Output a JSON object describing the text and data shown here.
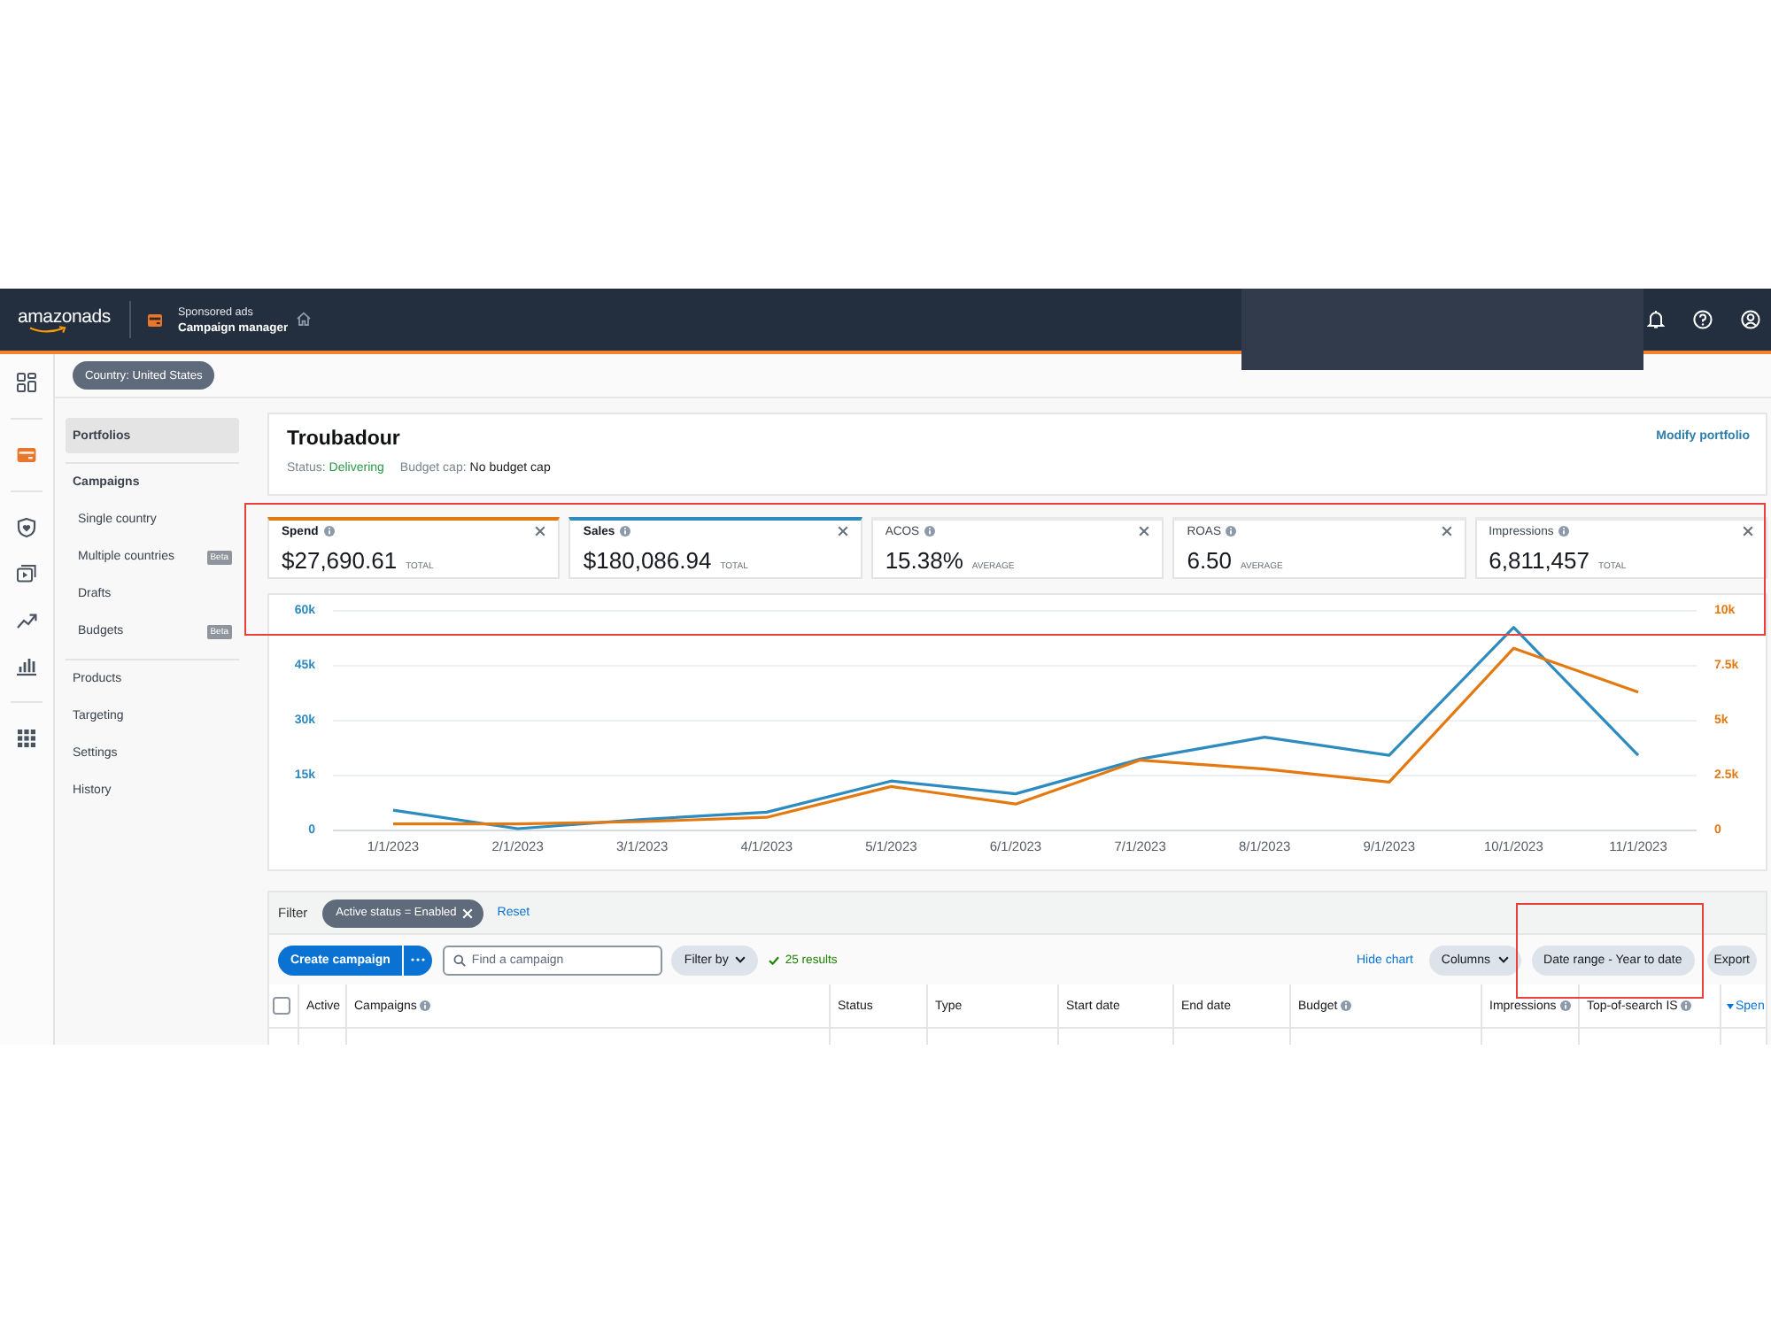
{
  "header": {
    "logo": "amazonads",
    "section": "Sponsored ads",
    "title": "Campaign manager",
    "redacted": true
  },
  "rail": {
    "groups": [
      {
        "items": [
          {
            "selected": false
          }
        ]
      },
      {
        "items": [
          {
            "selected": true
          }
        ]
      },
      {
        "items": [
          {
            "selected": false
          },
          {
            "selected": false
          },
          {
            "selected": false
          },
          {
            "selected": false
          }
        ]
      },
      {
        "items": [
          {
            "selected": false
          }
        ]
      }
    ]
  },
  "country_filter": "Country: United States",
  "sidebar": {
    "items": [
      {
        "label": "Portfolios",
        "selected": true
      },
      {
        "label": "Campaigns",
        "selected": false,
        "children": [
          {
            "label": "Single country",
            "selected": false
          },
          {
            "label": "Multiple countries",
            "selected": false,
            "badge": "Beta"
          },
          {
            "label": "Drafts",
            "selected": false
          },
          {
            "label": "Budgets",
            "selected": false,
            "badge": "Beta"
          }
        ]
      },
      {
        "label": "Products",
        "selected": false
      },
      {
        "label": "Targeting",
        "selected": false
      },
      {
        "label": "Settings",
        "selected": false
      },
      {
        "label": "History",
        "selected": false
      }
    ]
  },
  "portfolio": {
    "name": "Troubadour",
    "status_label": "Status:",
    "status": "Delivering",
    "budget_label": "Budget cap:",
    "budget": "No budget cap",
    "action": "Modify portfolio"
  },
  "metrics": [
    {
      "label": "Spend",
      "value": "$27,690.61",
      "unit": "TOTAL",
      "selected": true,
      "color": "#e47911"
    },
    {
      "label": "Sales",
      "value": "$180,086.94",
      "unit": "TOTAL",
      "selected": true,
      "color": "#2e8bc0"
    },
    {
      "label": "ACOS",
      "value": "15.38%",
      "unit": "AVERAGE",
      "selected": false
    },
    {
      "label": "ROAS",
      "value": "6.50",
      "unit": "AVERAGE",
      "selected": false
    },
    {
      "label": "Impressions",
      "value": "6,811,457",
      "unit": "TOTAL",
      "selected": false
    }
  ],
  "chart": {
    "chart_data": {
      "type": "line",
      "grid": true,
      "categories": [
        "1/1/2023",
        "2/1/2023",
        "3/1/2023",
        "4/1/2023",
        "5/1/2023",
        "6/1/2023",
        "7/1/2023",
        "8/1/2023",
        "9/1/2023",
        "10/1/2023",
        "11/1/2023"
      ],
      "series": [
        {
          "color": "#2e8bc0",
          "values": [
            5500,
            500,
            3000,
            5000,
            13500,
            10000,
            19500,
            25500,
            20500,
            55500,
            20500
          ]
        },
        {
          "color": "#e47911",
          "axis": "y2",
          "values": [
            300,
            300,
            400,
            600,
            2000,
            1200,
            3200,
            2800,
            2200,
            8300,
            6300
          ]
        }
      ],
      "ylim": [
        0,
        60000
      ],
      "yticks": [
        {
          "value": 0,
          "label": "0"
        },
        {
          "value": 15000,
          "label": "15k"
        },
        {
          "value": 30000,
          "label": "30k"
        },
        {
          "value": 45000,
          "label": "45k"
        },
        {
          "value": 60000,
          "label": "60k"
        }
      ],
      "y2lim": [
        0,
        10000
      ],
      "y2ticks": [
        {
          "value": 0,
          "label": "0"
        },
        {
          "value": 2500,
          "label": "2.5k"
        },
        {
          "value": 5000,
          "label": "5k"
        },
        {
          "value": 7500,
          "label": "7.5k"
        },
        {
          "value": 10000,
          "label": "10k"
        }
      ]
    }
  },
  "filter": {
    "label": "Filter",
    "chips": [
      {
        "label": "Active status = Enabled"
      }
    ],
    "reset": "Reset"
  },
  "toolbar": {
    "create": "Create campaign",
    "search": {
      "placeholder": "Find a campaign"
    },
    "filter_by": "Filter by",
    "results": "25 results",
    "hide_chart": "Hide chart",
    "columns": "Columns",
    "date_range": "Date range - Year to date",
    "export": "Export"
  },
  "table": {
    "select_all": {
      "checked": false
    },
    "columns": [
      {
        "label": "Active",
        "info": false,
        "sorted": false
      },
      {
        "label": "Campaigns",
        "info": true,
        "sorted": false
      },
      {
        "label": "Status",
        "info": false,
        "sorted": false
      },
      {
        "label": "Type",
        "info": false,
        "sorted": false
      },
      {
        "label": "Start date",
        "info": false,
        "sorted": false
      },
      {
        "label": "End date",
        "info": false,
        "sorted": false
      },
      {
        "label": "Budget",
        "info": true,
        "sorted": false
      },
      {
        "label": "Impressions",
        "info": true,
        "sorted": false
      },
      {
        "label": "Top-of-search IS",
        "info": true,
        "sorted": false
      },
      {
        "label": "Spen",
        "info": false,
        "sorted": true
      }
    ]
  },
  "annotations": [
    {
      "kind": "frame"
    },
    {
      "kind": "frame"
    }
  ]
}
